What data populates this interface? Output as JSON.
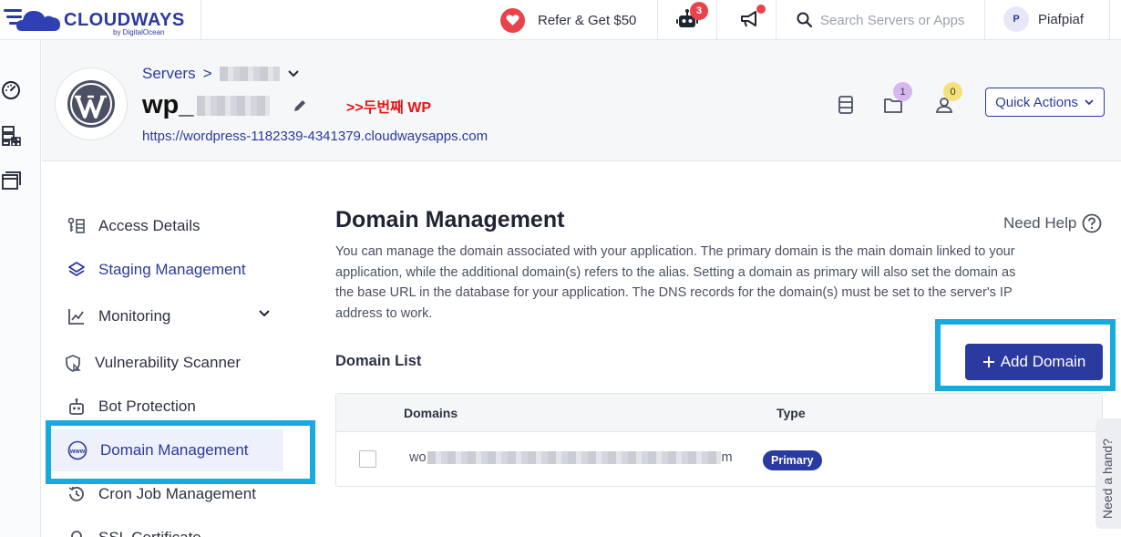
{
  "topbar": {
    "brand": "CLOUDWAYS",
    "brand_sub": "by DigitalOcean",
    "refer_label": "Refer & Get $50",
    "bot_badge": "3",
    "search_placeholder": "Search Servers or Apps",
    "user_initial": "P",
    "user_name": "Piafpiaf"
  },
  "header": {
    "breadcrumb_servers": "Servers",
    "breadcrumb_sep": ">",
    "app_name_prefix": "wp_",
    "annotation": ">>두번째 WP",
    "app_url": "https://wordpress-1182339-4341379.cloudwaysapps.com",
    "files_badge": "1",
    "users_badge": "0",
    "quick_actions_label": "Quick Actions"
  },
  "subnav": {
    "items": [
      {
        "label": "Access Details"
      },
      {
        "label": "Staging Management"
      },
      {
        "label": "Monitoring"
      },
      {
        "label": "Vulnerability Scanner"
      },
      {
        "label": "Bot Protection"
      },
      {
        "label": "Domain Management"
      },
      {
        "label": "Cron Job Management"
      },
      {
        "label": "SSL Certificate"
      }
    ]
  },
  "main": {
    "title": "Domain Management",
    "help_label": "Need Help",
    "description": "You can manage the domain associated with your application. The primary domain is the main domain linked to your application, while the additional domain(s) refers to the alias. Setting a domain as primary will also set the domain as the base URL in the database for your application. The DNS records for the domain(s) must be set to the server's IP address to work.",
    "list_title": "Domain List",
    "add_domain_label": "Add Domain",
    "table": {
      "headers": [
        "Domains",
        "Type"
      ],
      "rows": [
        {
          "domain_start": "wo",
          "domain_end": "m",
          "type": "Primary"
        }
      ]
    }
  },
  "help_widget": {
    "label": "Need a hand?"
  },
  "colors": {
    "brand": "#2b3a9e",
    "alert": "#e8424b",
    "highlight": "#16aae0",
    "annotation": "#e41414"
  }
}
